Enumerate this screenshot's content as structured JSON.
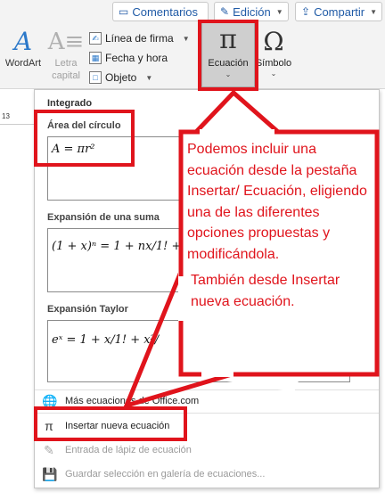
{
  "ribbon": {
    "comments_label": "Comentarios",
    "edit_label": "Edición",
    "share_label": "Compartir",
    "wordart_label": "WordArt",
    "letra_capital_label_1": "Letra",
    "letra_capital_label_2": "capital",
    "signature_line_label": "Línea de firma",
    "date_time_label": "Fecha y hora",
    "object_label": "Objeto",
    "equation_label": "Ecuación",
    "symbol_label": "Símbolo",
    "equation_glyph": "π",
    "symbol_glyph": "Ω",
    "wordart_glyph": "A",
    "letra_glyph": "A≡"
  },
  "ruler_text": "13",
  "gallery": {
    "section_title": "Integrado",
    "cards": [
      {
        "title": "Área del círculo",
        "equation": "A = πr²"
      },
      {
        "title": "Expansión de una suma",
        "equation": "(1 + x)ⁿ = 1 + nx/1! + n"
      },
      {
        "title": "Expansión Taylor",
        "equation": "eˣ = 1 + x/1! + x²/"
      }
    ],
    "menu": [
      {
        "label": "Más ecuaciones de Office.com",
        "icon": "globe-icon",
        "glyph": "🌐",
        "enabled": true
      },
      {
        "label": "Insertar nueva ecuación",
        "icon": "pi-icon",
        "glyph": "π",
        "enabled": true
      },
      {
        "label": "Entrada de lápiz de ecuación",
        "icon": "pen-icon",
        "glyph": "✎",
        "enabled": false
      },
      {
        "label": "Guardar selección en galería de ecuaciones...",
        "icon": "save-icon",
        "glyph": "💾",
        "enabled": false
      }
    ]
  },
  "callout": {
    "paragraph_1": "Podemos incluir una ecuación desde la pestaña Insertar/ Ecuación, eligiendo una de las diferentes opciones propuestas y modificándola.",
    "paragraph_2": "También desde Insertar nueva ecuación."
  },
  "colors": {
    "annotation_red": "#e0141c",
    "accent_blue": "#1f5aa6"
  }
}
